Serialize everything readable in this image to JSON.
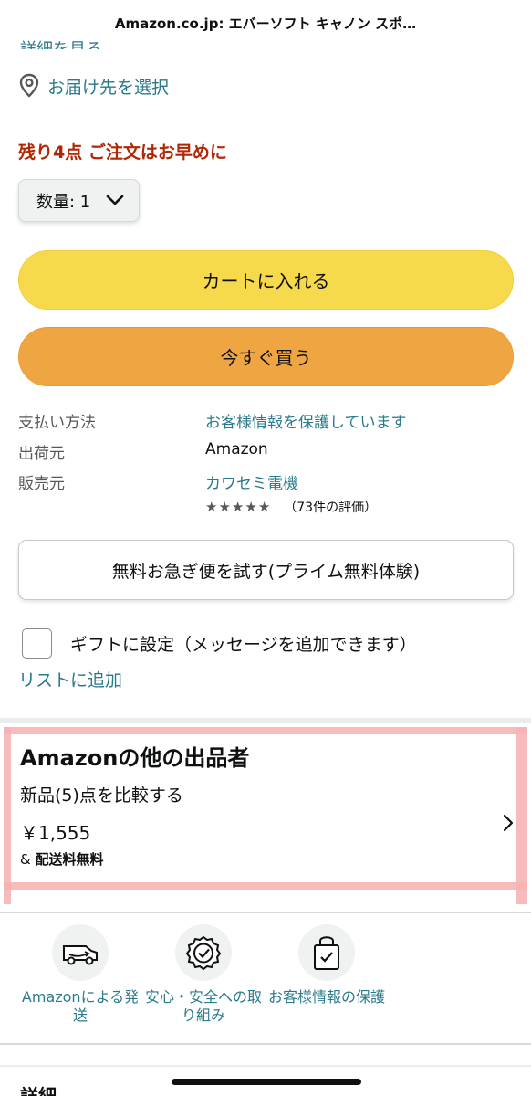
{
  "header": {
    "title": "Amazon.co.jp: エバーソフト キャノン スポ…"
  },
  "top_cut_text": "詳細を見る",
  "deliver": {
    "label": "お届け先を選択",
    "icon": "location-pin-icon"
  },
  "stock": {
    "text": "残り4点 ご注文はお早めに"
  },
  "quantity": {
    "label": "数量: 1"
  },
  "buttons": {
    "add_to_cart": "カートに入れる",
    "buy_now": "今すぐ買う"
  },
  "info": [
    {
      "key": "支払い方法",
      "value": "お客様情報を保護しています"
    },
    {
      "key": "出荷元",
      "value": "Amazon"
    },
    {
      "key": "販売元",
      "value": "カワセミ電機"
    }
  ],
  "rating": {
    "stars": [
      "★",
      "★",
      "★",
      "★",
      "★"
    ],
    "count": "（73件の評価）"
  },
  "prime_trial": {
    "label": "無料お急ぎ便を試す(プライム無料体験)"
  },
  "gift": {
    "label": "ギフトに設定（メッセージを追加できます）"
  },
  "add_to_list": {
    "label": "リストに追加"
  },
  "other_sellers": {
    "heading": "Amazonの他の出品者",
    "compare": "新品(5)点を比較する",
    "price": "￥1,555",
    "shipping_prefix": "& ",
    "shipping": "配送料無料"
  },
  "features": [
    {
      "icon": "delivery-van-icon",
      "label": "Amazonによる発送"
    },
    {
      "icon": "safety-badge-icon",
      "label": "安心・安全への取り組み"
    },
    {
      "icon": "secure-bag-icon",
      "label": "お客様情報の保護"
    }
  ],
  "details_cut": "詳細",
  "colors": {
    "link": "#2a7a8c",
    "stock": "#b12704",
    "cart": "#f7d94c",
    "buy": "#f0a543",
    "highlight": "#f6b4b4"
  }
}
